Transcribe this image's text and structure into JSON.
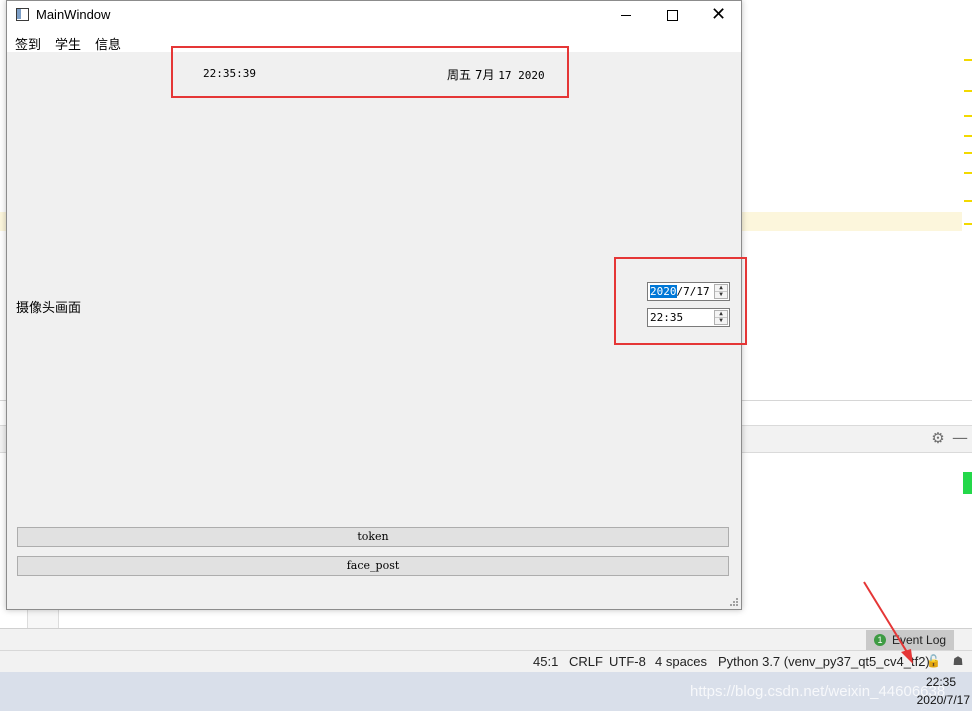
{
  "ide": {
    "toolstrip": {
      "settings_icon": "gear-icon",
      "hide_icon": "minus-icon"
    },
    "event_log": {
      "badge": "1",
      "label": "Event Log"
    },
    "statusbar": {
      "position": "45:1",
      "line_sep": "CRLF",
      "encoding": "UTF-8",
      "indent": "4 spaces",
      "interpreter": "Python 3.7 (venv_py37_qt5_cv4_tf2)"
    }
  },
  "taskbar": {
    "time": "22:35",
    "date": "2020/7/17"
  },
  "watermark": "https://blog.csdn.net/weixin_44606638",
  "window": {
    "title": "MainWindow",
    "controls": {
      "minimize": "minimize-icon",
      "maximize": "maximize-icon",
      "close": "✕"
    },
    "menu": [
      "签到",
      "学生",
      "信息"
    ]
  },
  "clock": {
    "time": "22:35:39",
    "weekday_month": "周五 7月",
    "day_year": "17 2020"
  },
  "camera_label": "摄像头画面",
  "date_edit": {
    "selected": "2020",
    "rest": "/7/17"
  },
  "time_edit": {
    "value": "22:35"
  },
  "buttons": {
    "token": "token",
    "face_post": "face_post"
  },
  "colors": {
    "annotation_red": "#e53636",
    "selection_blue": "#0078d7",
    "window_bg": "#f0f0f0"
  }
}
